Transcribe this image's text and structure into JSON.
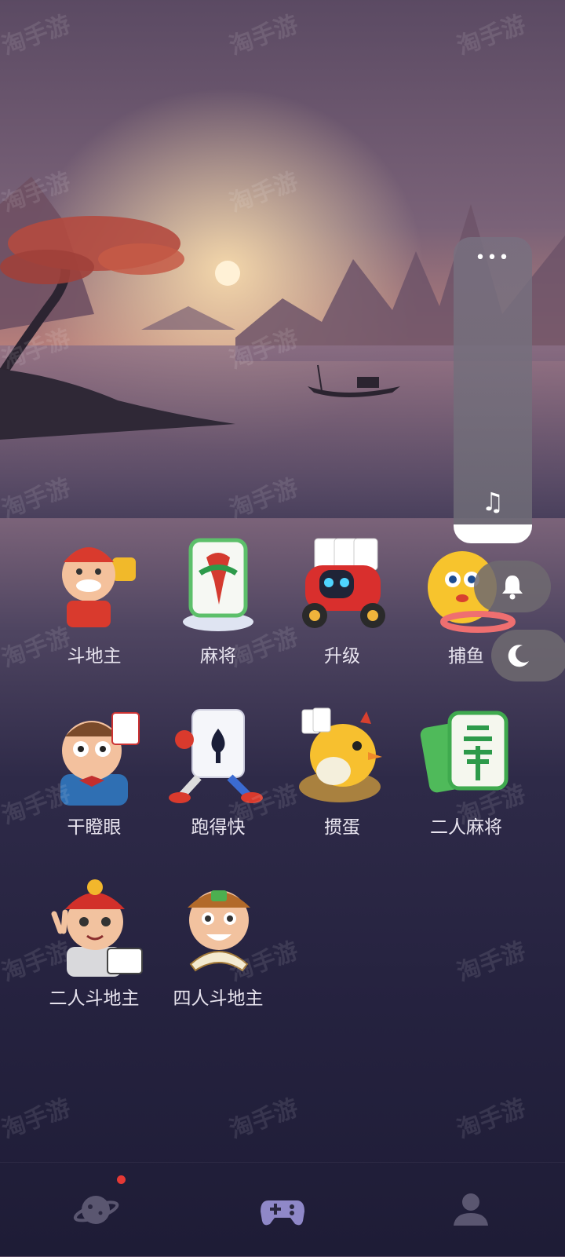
{
  "colors": {
    "label_text": "#e8e4ef",
    "nav_icon_inactive": "#5a5670",
    "nav_icon_active": "#8f88c8",
    "notification_dot": "#e53935"
  },
  "watermark": "淘手游",
  "side_panel": {
    "menu_icon": "more-dots-icon",
    "menu_glyph": "•••",
    "music_icon": "music-note-icon",
    "music_glyph": "♫"
  },
  "quick_buttons": [
    {
      "icon": "bell-icon"
    },
    {
      "icon": "moon-icon"
    }
  ],
  "games": [
    {
      "label": "斗地主",
      "icon": "landlord-character-icon"
    },
    {
      "label": "麻将",
      "icon": "mahjong-tile-icon"
    },
    {
      "label": "升级",
      "icon": "card-car-icon"
    },
    {
      "label": "捕鱼",
      "icon": "fish-icon"
    },
    {
      "label": "干瞪眼",
      "icon": "staring-man-icon"
    },
    {
      "label": "跑得快",
      "icon": "running-card-icon"
    },
    {
      "label": "掼蛋",
      "icon": "chicken-egg-icon"
    },
    {
      "label": "二人麻将",
      "icon": "two-player-mahjong-icon"
    },
    {
      "label": "二人斗地主",
      "icon": "two-player-landlord-icon"
    },
    {
      "label": "四人斗地主",
      "icon": "four-player-landlord-icon"
    }
  ],
  "bottom_nav": [
    {
      "name": "planet",
      "icon": "planet-icon",
      "has_badge": true
    },
    {
      "name": "games",
      "icon": "gamepad-icon",
      "active": true
    },
    {
      "name": "profile",
      "icon": "user-icon"
    }
  ]
}
